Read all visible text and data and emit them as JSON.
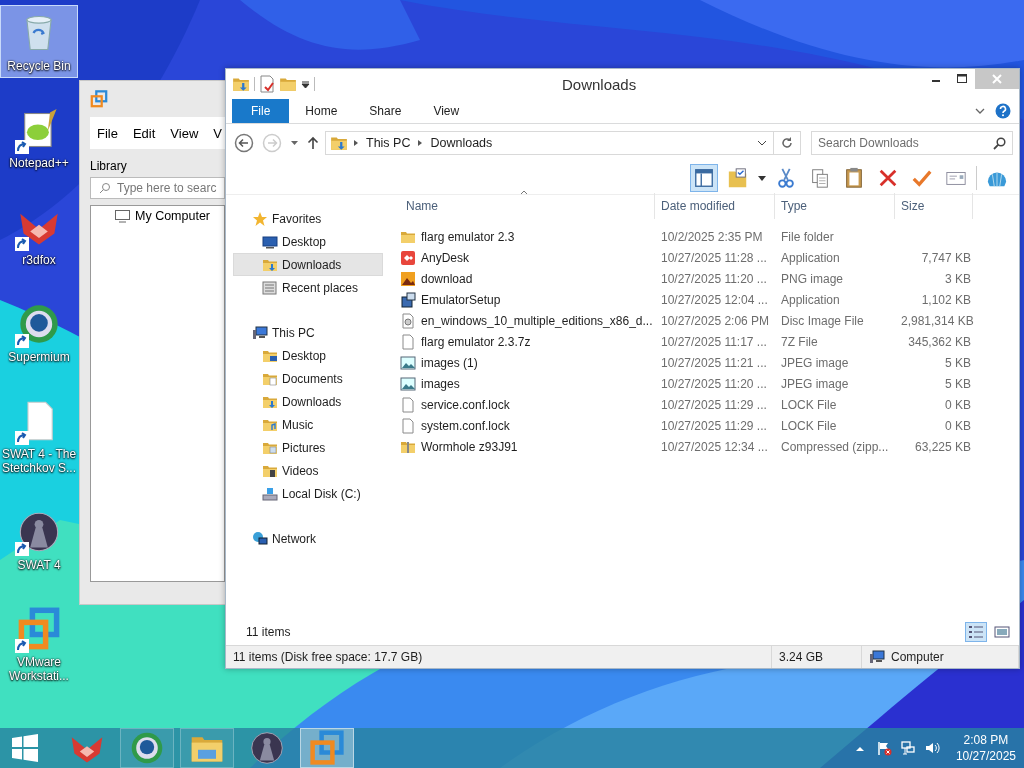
{
  "desktop_icons": [
    {
      "kind": "recycle-bin",
      "label": "Recycle Bin",
      "selected": true,
      "shortcut": false
    },
    {
      "kind": "notepad",
      "label": "Notepad++",
      "selected": false,
      "shortcut": true
    },
    {
      "kind": "fox",
      "label": "r3dfox",
      "selected": false,
      "shortcut": true
    },
    {
      "kind": "browser",
      "label": "Supermium",
      "selected": false,
      "shortcut": true
    },
    {
      "kind": "document",
      "label": "SWAT 4 - The Stetchkov S...",
      "selected": false,
      "shortcut": true
    },
    {
      "kind": "game",
      "label": "SWAT 4",
      "selected": false,
      "shortcut": true
    },
    {
      "kind": "vmware",
      "label": "VMware Workstati...",
      "selected": false,
      "shortcut": true
    }
  ],
  "background_window": {
    "menu": [
      "File",
      "Edit",
      "View",
      "V"
    ],
    "panel_title": "Library",
    "search": {
      "placeholder": "Type here to searc"
    },
    "tree": [
      {
        "label": "My Computer"
      }
    ]
  },
  "explorer": {
    "title": "Downloads",
    "ribbon_tabs": [
      {
        "label": "File",
        "selected": true
      },
      {
        "label": "Home",
        "selected": false
      },
      {
        "label": "Share",
        "selected": false
      },
      {
        "label": "View",
        "selected": false
      }
    ],
    "breadcrumbs": [
      "This PC",
      "Downloads"
    ],
    "search": {
      "placeholder": "Search Downloads"
    },
    "toolbar": [
      {
        "kind": "preview-pane",
        "selected": true
      },
      {
        "kind": "folder-options",
        "selected": false
      },
      {
        "kind": "cut",
        "selected": false
      },
      {
        "kind": "copy",
        "selected": false
      },
      {
        "kind": "paste",
        "selected": false
      },
      {
        "kind": "delete",
        "selected": false
      },
      {
        "kind": "accept",
        "selected": false
      },
      {
        "kind": "rename",
        "selected": false
      },
      {
        "kind": "shell",
        "selected": false
      }
    ],
    "navigation": [
      {
        "kind": "star",
        "label": "Favorites",
        "selected": false,
        "children": [
          {
            "kind": "desktop",
            "label": "Desktop",
            "selected": false
          },
          {
            "kind": "downloads",
            "label": "Downloads",
            "selected": true
          },
          {
            "kind": "recent",
            "label": "Recent places",
            "selected": false
          }
        ]
      },
      {
        "kind": "pc",
        "label": "This PC",
        "selected": false,
        "children": [
          {
            "kind": "desktop-folder",
            "label": "Desktop",
            "selected": false
          },
          {
            "kind": "documents",
            "label": "Documents",
            "selected": false
          },
          {
            "kind": "downloads",
            "label": "Downloads",
            "selected": false
          },
          {
            "kind": "music",
            "label": "Music",
            "selected": false
          },
          {
            "kind": "pictures",
            "label": "Pictures",
            "selected": false
          },
          {
            "kind": "videos",
            "label": "Videos",
            "selected": false
          },
          {
            "kind": "disk",
            "label": "Local Disk (C:)",
            "selected": false
          }
        ]
      },
      {
        "kind": "network",
        "label": "Network",
        "selected": false
      }
    ],
    "columns": [
      "Name",
      "Date modified",
      "Type",
      "Size"
    ],
    "files": [
      {
        "kind": "folder",
        "name": "flarg emulator 2.3",
        "date": "10/2/2025 2:35 PM",
        "type": "File folder"
      },
      {
        "kind": "anydesk",
        "name": "AnyDesk",
        "date": "10/27/2025 11:28 ...",
        "type": "Application",
        "size": "7,747 KB"
      },
      {
        "kind": "png",
        "name": "download",
        "date": "10/27/2025 11:20 ...",
        "type": "PNG image",
        "size": "3 KB"
      },
      {
        "kind": "setup",
        "name": "EmulatorSetup",
        "date": "10/27/2025 12:04 ...",
        "type": "Application",
        "size": "1,102 KB"
      },
      {
        "kind": "disc",
        "name": "en_windows_10_multiple_editions_x86_d...",
        "date": "10/27/2025 2:06 PM",
        "type": "Disc Image File",
        "size": "2,981,314 KB"
      },
      {
        "kind": "file",
        "name": "flarg emulator 2.3.7z",
        "date": "10/27/2025 11:17 ...",
        "type": "7Z File",
        "size": "345,362 KB"
      },
      {
        "kind": "jpeg",
        "name": "images (1)",
        "date": "10/27/2025 11:21 ...",
        "type": "JPEG image",
        "size": "5 KB"
      },
      {
        "kind": "jpeg",
        "name": "images",
        "date": "10/27/2025 11:20 ...",
        "type": "JPEG image",
        "size": "5 KB"
      },
      {
        "kind": "file",
        "name": "service.conf.lock",
        "date": "10/27/2025 11:29 ...",
        "type": "LOCK File",
        "size": "0 KB"
      },
      {
        "kind": "file",
        "name": "system.conf.lock",
        "date": "10/27/2025 11:29 ...",
        "type": "LOCK File",
        "size": "0 KB"
      },
      {
        "kind": "zip",
        "name": "Wormhole z93J91",
        "date": "10/27/2025 12:34 ...",
        "type": "Compressed (zipp...",
        "size": "63,225 KB"
      }
    ],
    "item_count": "11 items",
    "view_buttons": [
      {
        "kind": "details",
        "selected": true
      },
      {
        "kind": "large-icons",
        "selected": false
      }
    ],
    "status_bar": {
      "summary": "11 items (Disk free space: 17.7 GB)",
      "size": "3.24 GB",
      "location": "Computer"
    }
  },
  "taskbar": {
    "apps": [
      {
        "kind": "fox",
        "running": false,
        "selected": false
      },
      {
        "kind": "browser",
        "running": true,
        "selected": false
      },
      {
        "kind": "explorer",
        "running": true,
        "selected": false
      },
      {
        "kind": "game",
        "running": false,
        "selected": false
      },
      {
        "kind": "vmware",
        "running": true,
        "selected": true
      }
    ],
    "tray": [
      {
        "kind": "chevron"
      },
      {
        "kind": "flag"
      },
      {
        "kind": "network"
      },
      {
        "kind": "volume"
      }
    ],
    "time": "2:08 PM",
    "date": "10/27/2025"
  }
}
